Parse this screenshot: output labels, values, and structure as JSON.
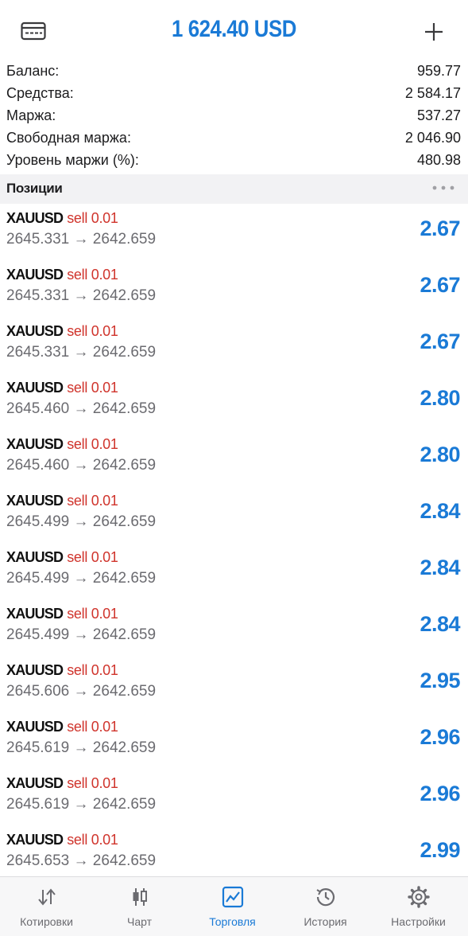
{
  "header": {
    "title": "1 624.40 USD",
    "left_icon": "account-card-icon",
    "right_icon": "plus-icon"
  },
  "summary": [
    {
      "label": "Баланс:",
      "value": "959.77"
    },
    {
      "label": "Средства:",
      "value": "2 584.17"
    },
    {
      "label": "Маржа:",
      "value": "537.27"
    },
    {
      "label": "Свободная маржа:",
      "value": "2 046.90"
    },
    {
      "label": "Уровень маржи (%):",
      "value": "480.98"
    }
  ],
  "section": {
    "title": "Позиции",
    "more_icon": "more-dots-icon"
  },
  "positions": [
    {
      "symbol": "XAUUSD",
      "direction": "sell 0.01",
      "prices": "2645.331 → 2642.659",
      "profit": "2.67"
    },
    {
      "symbol": "XAUUSD",
      "direction": "sell 0.01",
      "prices": "2645.331 → 2642.659",
      "profit": "2.67"
    },
    {
      "symbol": "XAUUSD",
      "direction": "sell 0.01",
      "prices": "2645.331 → 2642.659",
      "profit": "2.67"
    },
    {
      "symbol": "XAUUSD",
      "direction": "sell 0.01",
      "prices": "2645.460 → 2642.659",
      "profit": "2.80"
    },
    {
      "symbol": "XAUUSD",
      "direction": "sell 0.01",
      "prices": "2645.460 → 2642.659",
      "profit": "2.80"
    },
    {
      "symbol": "XAUUSD",
      "direction": "sell 0.01",
      "prices": "2645.499 → 2642.659",
      "profit": "2.84"
    },
    {
      "symbol": "XAUUSD",
      "direction": "sell 0.01",
      "prices": "2645.499 → 2642.659",
      "profit": "2.84"
    },
    {
      "symbol": "XAUUSD",
      "direction": "sell 0.01",
      "prices": "2645.499 → 2642.659",
      "profit": "2.84"
    },
    {
      "symbol": "XAUUSD",
      "direction": "sell 0.01",
      "prices": "2645.606 → 2642.659",
      "profit": "2.95"
    },
    {
      "symbol": "XAUUSD",
      "direction": "sell 0.01",
      "prices": "2645.619 → 2642.659",
      "profit": "2.96"
    },
    {
      "symbol": "XAUUSD",
      "direction": "sell 0.01",
      "prices": "2645.619 → 2642.659",
      "profit": "2.96"
    },
    {
      "symbol": "XAUUSD",
      "direction": "sell 0.01",
      "prices": "2645.653 → 2642.659",
      "profit": "2.99"
    }
  ],
  "tabs": [
    {
      "label": "Котировки",
      "icon": "quotes-arrows-icon",
      "active": false
    },
    {
      "label": "Чарт",
      "icon": "candlestick-chart-icon",
      "active": false
    },
    {
      "label": "Торговля",
      "icon": "trade-chart-icon",
      "active": true
    },
    {
      "label": "История",
      "icon": "history-clock-icon",
      "active": false
    },
    {
      "label": "Настройки",
      "icon": "settings-gear-icon",
      "active": false
    }
  ],
  "colors": {
    "accent": "#1a7ad6",
    "sell": "#d0342c",
    "secondary_text": "#6b6b70",
    "section_bg": "#f2f2f4"
  }
}
